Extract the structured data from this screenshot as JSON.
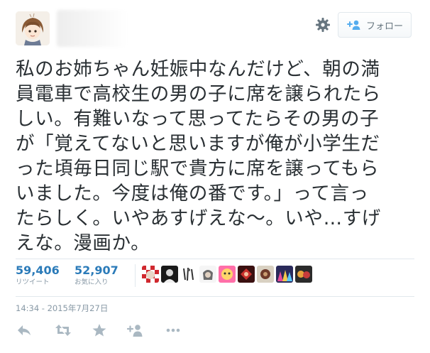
{
  "header": {
    "follow_label": "フォロー",
    "gear_icon": "gear-icon",
    "follow_icon": "add-user-icon"
  },
  "tweet": {
    "text": "私のお姉ちゃん妊娠中なんだけど、朝の満員電車で高校生の男の子に席を譲られたらしい。有難いなって思ってたらその男の子が「覚えてないと思いますが俺が小学生だった頃毎日同じ駅で貴方に席を譲ってもらいました。今度は俺の番です。」って言ったらしく。いやあすげえな〜。いや…すげえな。漫画か。",
    "lines": [
      "私のお姉ちゃん妊娠中なんだけど、朝の満",
      "員電車で高校生の男の子に席を譲られたら",
      "しい。有難いなって思ってたらその男の子",
      "が「覚えてないと思いますが俺が小学生だ",
      "った頃毎日同じ駅で貴方に席を譲ってもら",
      "いました。今度は俺の番です。」って言っ",
      "たらしく。いやあすげえな〜。いや…すげ",
      "えな。漫画か。"
    ]
  },
  "stats": {
    "retweets": {
      "count": "59,406",
      "label": "リツイート"
    },
    "favorites": {
      "count": "52,907",
      "label": "お気に入り"
    }
  },
  "timestamp": "14:34 - 2015年7月27日",
  "actions": [
    "reply-icon",
    "retweet-icon",
    "favorite-icon",
    "follow-icon",
    "more-icon"
  ],
  "colors": {
    "link": "#2b7bb9",
    "muted": "#8899a6",
    "text": "#292f33",
    "border": "#e1e8ed"
  }
}
